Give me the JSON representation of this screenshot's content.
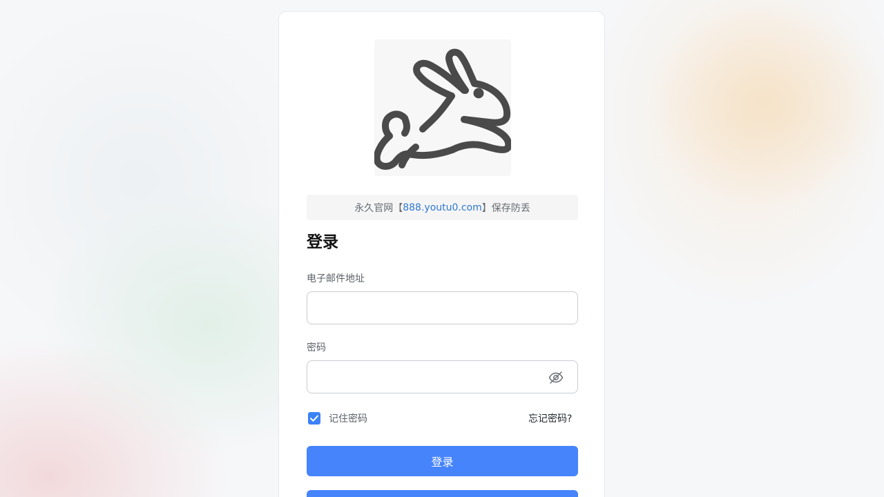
{
  "notice": {
    "prefix": "永久官网【",
    "link": "888.youtu0.com",
    "suffix": "】保存防丢"
  },
  "login": {
    "title": "登录",
    "email_label": "电子邮件地址",
    "email_value": "",
    "password_label": "密码",
    "password_value": "",
    "remember_label": "记住密码",
    "remember_checked": true,
    "forgot_label": "忘记密码?",
    "submit_label": "登录"
  },
  "icons": {
    "logo": "rabbit-icon",
    "password_toggle": "eye-off-icon",
    "checkbox": "check-icon"
  },
  "colors": {
    "primary": "#4684fc",
    "link": "#2f78cc",
    "checkbox": "#3b82f6"
  }
}
